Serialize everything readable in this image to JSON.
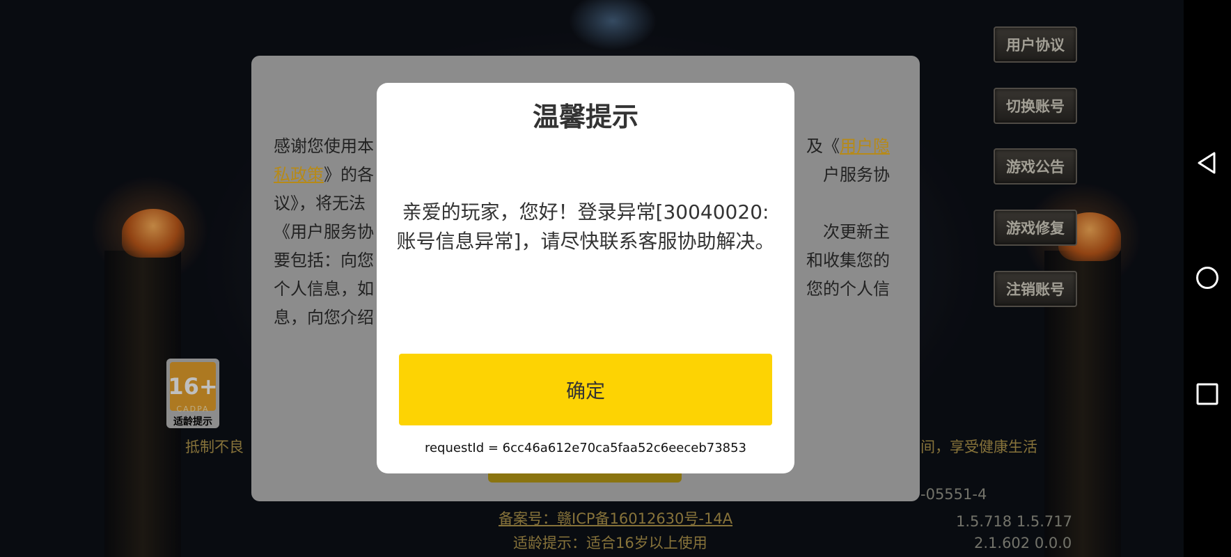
{
  "game_menu": {
    "items": [
      "用户协议",
      "切换账号",
      "游戏公告",
      "游戏修复",
      "注销账号"
    ]
  },
  "age_badge": {
    "rating": "16+",
    "brand": "CADPA",
    "label": "适龄提示"
  },
  "footer": {
    "left_notice": "抵制不良",
    "right_notice": "间，享受健康生活",
    "number_fragment": "-05551-4",
    "icp": "备案号：赣ICP备16012630号-14A",
    "age_hint": "适龄提示：适合16岁以上使用",
    "version_1": "1.5.718  1.5.717",
    "version_2": "2.1.602  0.0.0"
  },
  "agreement": {
    "line1_left": "感谢您使用本",
    "line1_right_prefix": "及《",
    "line1_link": "用户隐",
    "line2_link": "私政策",
    "line2_mid": "》的各",
    "line2_right": "户服务协",
    "line3_left": "议》，将无法",
    "line4_left": "《用户服务协",
    "line4_right": "次更新主",
    "line5_left": "要包括：向您",
    "line5_right": "和收集您的",
    "line6_left": "个人信息，如",
    "line6_right": "您的个人信",
    "line7_left": "息，向您介绍"
  },
  "dialog": {
    "title": "温馨提示",
    "message": "亲爱的玩家，您好！登录异常[30040020: 账号信息异常]，请尽快联系客服协助解决。",
    "confirm_label": "确定",
    "request_id": "requestId = 6cc46a612e70ca5faa52c6eeceb73853"
  },
  "nav_bar": {
    "icons": [
      "back-icon",
      "home-icon",
      "recents-icon"
    ]
  }
}
